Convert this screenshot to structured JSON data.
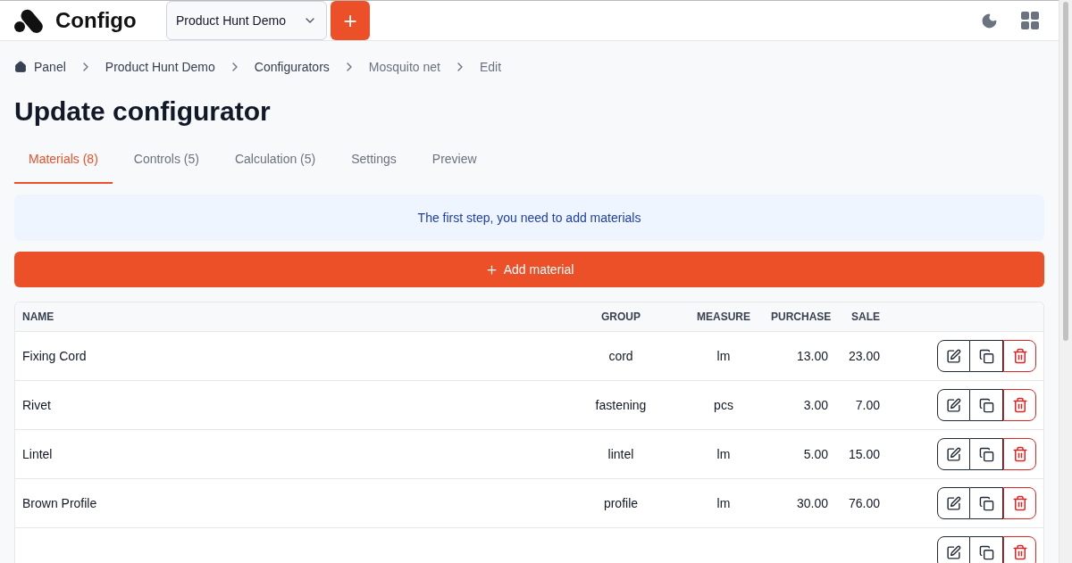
{
  "header": {
    "brand": "Configo",
    "project_select": {
      "value": "Product Hunt Demo"
    },
    "add_button": "+"
  },
  "breadcrumbs": [
    {
      "label": "Panel",
      "kind": "home",
      "current": false
    },
    {
      "label": "Product Hunt Demo",
      "kind": "link",
      "current": false
    },
    {
      "label": "Configurators",
      "kind": "link",
      "current": false
    },
    {
      "label": "Mosquito net",
      "kind": "link",
      "current": true
    },
    {
      "label": "Edit",
      "kind": "link",
      "current": true
    }
  ],
  "title": "Update configurator",
  "tabs": [
    {
      "label": "Materials (8)",
      "selected": true
    },
    {
      "label": "Controls (5)",
      "selected": false
    },
    {
      "label": "Calculation (5)",
      "selected": false
    },
    {
      "label": "Settings",
      "selected": false
    },
    {
      "label": "Preview",
      "selected": false
    }
  ],
  "notice": "The first step, you need to add materials",
  "add_material_button": "Add material",
  "table": {
    "columns": [
      "NAME",
      "GROUP",
      "MEASURE",
      "PURCHASE",
      "SALE"
    ],
    "rows": [
      {
        "name": "Fixing Cord",
        "group": "cord",
        "measure": "lm",
        "purchase": "13.00",
        "sale": "23.00"
      },
      {
        "name": "Rivet",
        "group": "fastening",
        "measure": "pcs",
        "purchase": "3.00",
        "sale": "7.00"
      },
      {
        "name": "Lintel",
        "group": "lintel",
        "measure": "lm",
        "purchase": "5.00",
        "sale": "15.00"
      },
      {
        "name": "Brown Profile",
        "group": "profile",
        "measure": "lm",
        "purchase": "30.00",
        "sale": "76.00"
      }
    ],
    "more_rows_below": true
  }
}
